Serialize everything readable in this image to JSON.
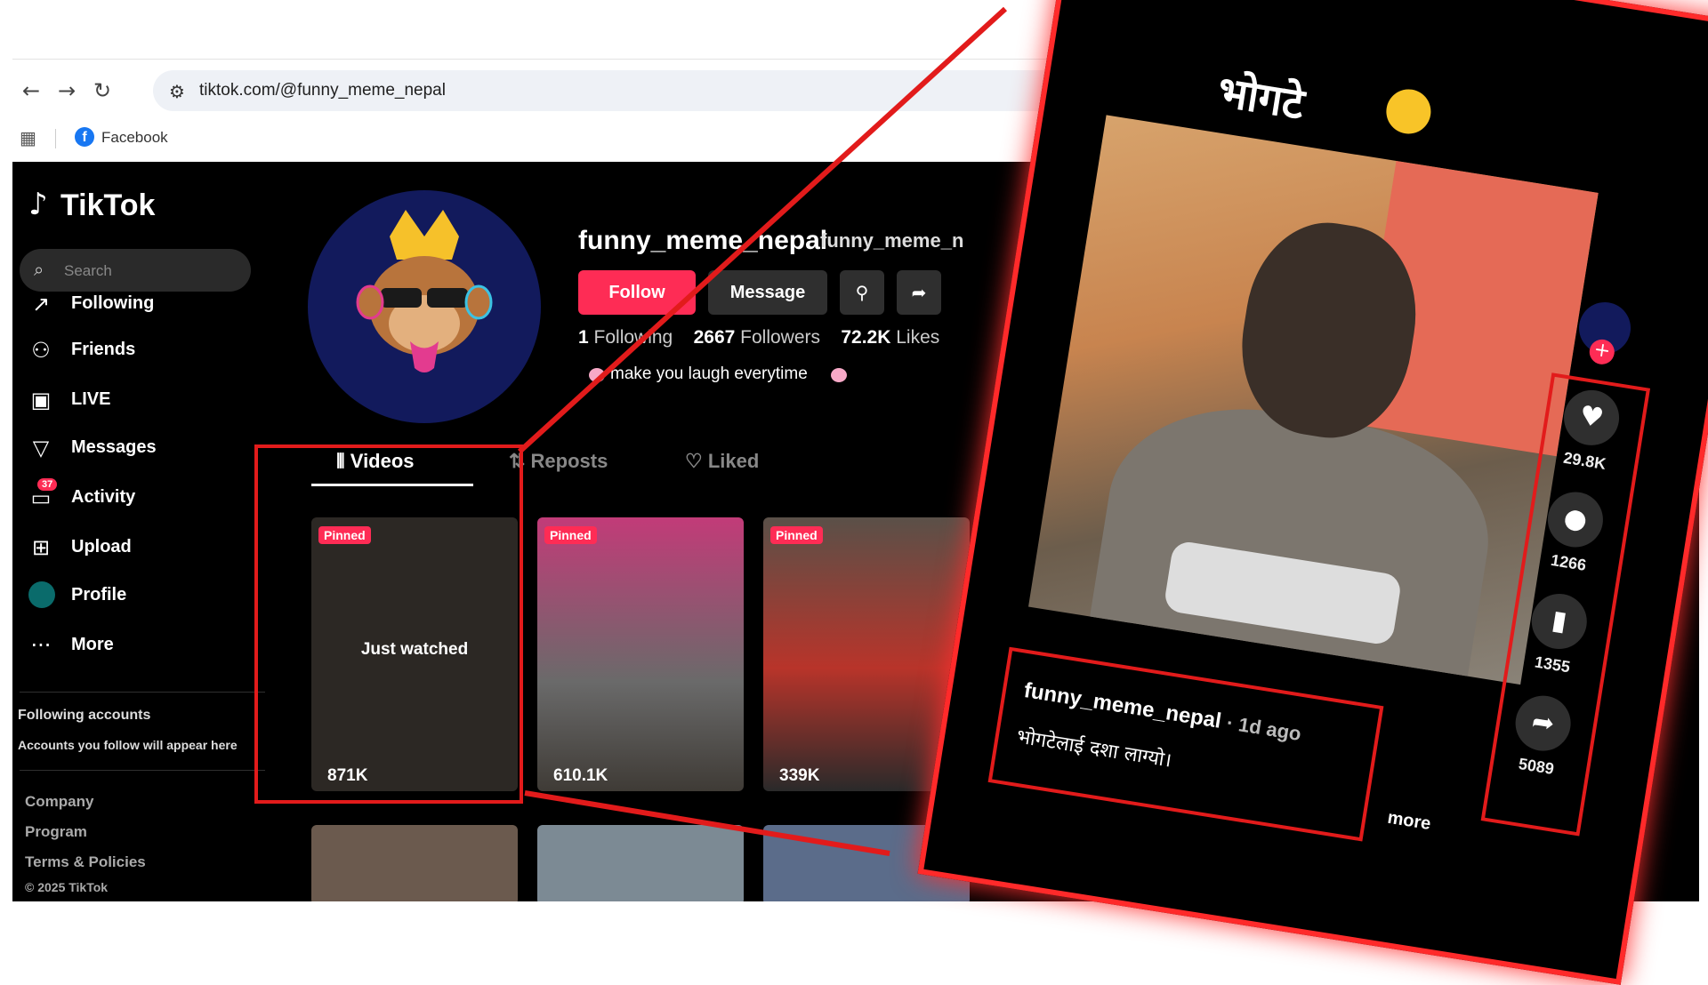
{
  "browser": {
    "url": "tiktok.com/@funny_meme_nepal",
    "bookmark_facebook": "Facebook"
  },
  "sidebar": {
    "logo": "TikTok",
    "search_placeholder": "Search",
    "items": [
      {
        "label": "Following",
        "icon": "following-icon"
      },
      {
        "label": "Friends",
        "icon": "friends-icon"
      },
      {
        "label": "LIVE",
        "icon": "live-icon"
      },
      {
        "label": "Messages",
        "icon": "messages-icon"
      },
      {
        "label": "Activity",
        "icon": "activity-icon",
        "badge": "37"
      },
      {
        "label": "Upload",
        "icon": "upload-icon"
      },
      {
        "label": "Profile",
        "icon": "profile-icon"
      },
      {
        "label": "More",
        "icon": "more-icon"
      }
    ],
    "following_accounts_title": "Following accounts",
    "following_accounts_text": "Accounts you follow will appear here",
    "footer": [
      "Company",
      "Program",
      "Terms & Policies"
    ],
    "copyright": "© 2025 TikTok"
  },
  "profile": {
    "username": "funny_meme_nepal",
    "handle": "funny_meme_n",
    "follow_label": "Follow",
    "message_label": "Message",
    "following_count": "1",
    "following_label": "Following",
    "followers_count": "2667",
    "followers_label": "Followers",
    "likes_count": "72.2K",
    "likes_label": "Likes",
    "bio": "make you laugh everytime"
  },
  "tabs": {
    "videos": "Videos",
    "reposts": "Reposts",
    "liked": "Liked"
  },
  "videos": [
    {
      "pinned": "Pinned",
      "views": "871K",
      "overlay": "Just watched"
    },
    {
      "pinned": "Pinned",
      "views": "610.1K"
    },
    {
      "pinned": "Pinned",
      "views": "339K"
    }
  ],
  "zoom": {
    "title": "भोगटे",
    "likes": "29.8K",
    "comments": "1266",
    "saves": "1355",
    "shares": "5089",
    "username": "funny_meme_nepal",
    "time": "· 1d ago",
    "caption": "भोगटेलाई दशा लाग्यो।",
    "more": "more"
  },
  "colors": {
    "accent": "#fe2c55",
    "annotation": "#e21b1b",
    "background": "#000000"
  }
}
